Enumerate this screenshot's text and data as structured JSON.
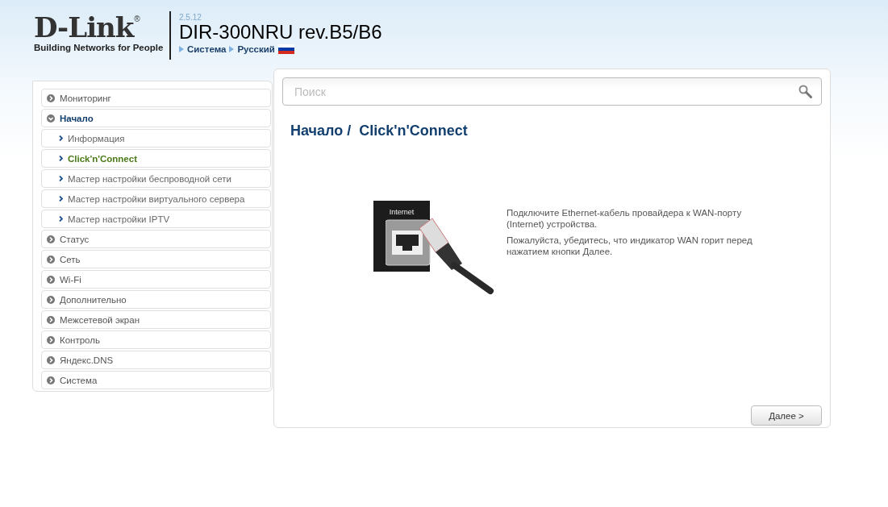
{
  "header": {
    "logo": "D-Link",
    "logo_mark": "®",
    "tagline": "Building Networks for People",
    "version": "2.5.12",
    "model": "DIR-300NRU rev.B5/B6",
    "links": [
      "Система",
      "Русский"
    ]
  },
  "sidebar": {
    "items": [
      {
        "label": "Мониторинг",
        "expanded": false
      },
      {
        "label": "Начало",
        "expanded": true,
        "children": [
          {
            "label": "Информация",
            "selected": false
          },
          {
            "label": "Click'n'Connect",
            "selected": true
          },
          {
            "label": "Мастер настройки беспроводной сети",
            "selected": false
          },
          {
            "label": "Мастер настройки виртуального сервера",
            "selected": false
          },
          {
            "label": "Мастер настройки IPTV",
            "selected": false
          }
        ]
      },
      {
        "label": "Статус",
        "expanded": false
      },
      {
        "label": "Сеть",
        "expanded": false
      },
      {
        "label": "Wi-Fi",
        "expanded": false
      },
      {
        "label": "Дополнительно",
        "expanded": false
      },
      {
        "label": "Межсетевой экран",
        "expanded": false
      },
      {
        "label": "Контроль",
        "expanded": false
      },
      {
        "label": "Яндекс.DNS",
        "expanded": false
      },
      {
        "label": "Система",
        "expanded": false
      }
    ]
  },
  "search": {
    "placeholder": "Поиск"
  },
  "page_title": "Начало /  Click'n'Connect",
  "illustration": {
    "label": "Internet"
  },
  "instructions": [
    "Подключите Ethernet-кабель провайдера к WAN-порту (Internet) устройства.",
    "Пожалуйста, убедитесь, что индикатор WAN горит перед нажатием кнопки Далее."
  ],
  "next_button": "Далее >"
}
